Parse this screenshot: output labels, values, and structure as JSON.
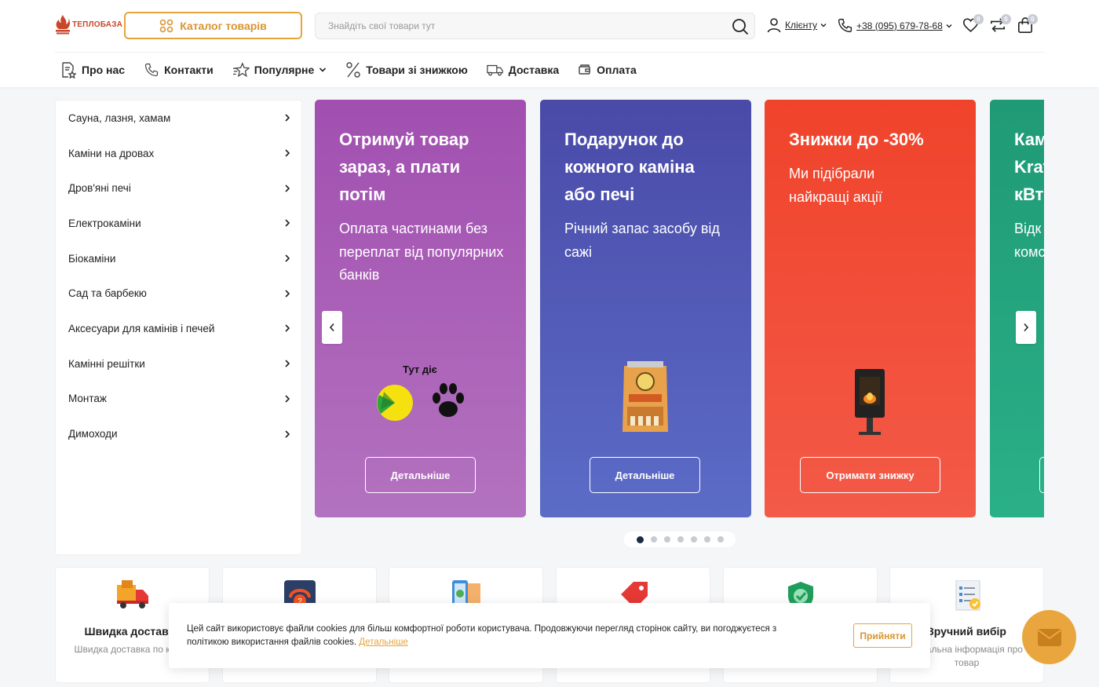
{
  "header": {
    "logo_text": "ТЕПЛОБАЗА",
    "catalog_label": "Каталог товарів",
    "search_placeholder": "Знайдіть свої товари тут",
    "account_label": "Клієнту",
    "phone": "+38 (095) 679-78-68",
    "wishlist_count": "0",
    "compare_count": "0",
    "cart_count": "0"
  },
  "nav": {
    "items": [
      {
        "label": "Про нас",
        "icon": "document-star-icon"
      },
      {
        "label": "Контакти",
        "icon": "phone-icon"
      },
      {
        "label": "Популярне",
        "icon": "star-icon"
      },
      {
        "label": "Товари зі знижкою",
        "icon": "percent-icon"
      },
      {
        "label": "Доставка",
        "icon": "truck-icon"
      },
      {
        "label": "Оплата",
        "icon": "wallet-icon"
      }
    ]
  },
  "sidebar": {
    "items": [
      {
        "label": "Сауна, лазня, хамам"
      },
      {
        "label": "Каміни на дровах"
      },
      {
        "label": "Дров'яні печі"
      },
      {
        "label": "Електрокаміни"
      },
      {
        "label": "Біокаміни"
      },
      {
        "label": "Сад та барбекю"
      },
      {
        "label": "Аксесуари для камінів і печей"
      },
      {
        "label": "Камінні решітки"
      },
      {
        "label": "Монтаж"
      },
      {
        "label": "Димоходи"
      }
    ]
  },
  "slides": [
    {
      "title": "Отримуй товар зараз, а плати потім",
      "text": "Оплата частинами без переплат від популярних банків",
      "image_label": "Тут діє",
      "button": "Детальніше",
      "color_top": "#a14fb0",
      "color_bottom": "#b372bf"
    },
    {
      "title": "Подарунок до кожного каміна або печі",
      "text": "Річний запас засобу від сажі",
      "button": "Детальніше",
      "color_top": "#4a4aa8",
      "color_bottom": "#5b6cc7"
    },
    {
      "title": "Знижки до -30%",
      "text": "Ми підібрали найкращі акції",
      "button": "Отримати знижку",
      "color_top": "#f0432b",
      "color_bottom": "#f35a48"
    },
    {
      "title": "Кам Krat кВт",
      "text": "Відк комс",
      "color_top": "#1f9a75",
      "color_bottom": "#2ab088"
    }
  ],
  "dots": {
    "count": 7,
    "active": 0
  },
  "features": [
    {
      "title": "Швидка доставка",
      "desc": "Швидка доставка по країні",
      "icon": "delivery-truck-icon"
    },
    {
      "title": "",
      "desc": "",
      "icon": "support-icon"
    },
    {
      "title": "",
      "desc": "",
      "icon": "mobile-payment-icon"
    },
    {
      "title": "",
      "desc": "",
      "icon": "price-tag-icon"
    },
    {
      "title": "",
      "desc": "",
      "icon": "shield-check-icon"
    },
    {
      "title": "Зручний вибір",
      "desc": "Детальна інформація про товар",
      "icon": "checklist-icon"
    }
  ],
  "cookie": {
    "text": "Цей сайт використовує файли cookies для більш комфортної роботи користувача. Продовжуючи перегляд сторінок сайту, ви погоджуєтеся з політикою використання файлів cookies.",
    "more_link": "Детальніше",
    "accept_label": "Прийняти"
  },
  "colors": {
    "accent": "#e6a43a",
    "logo_red": "#c8472b",
    "dark_dot": "#1b2b45"
  }
}
